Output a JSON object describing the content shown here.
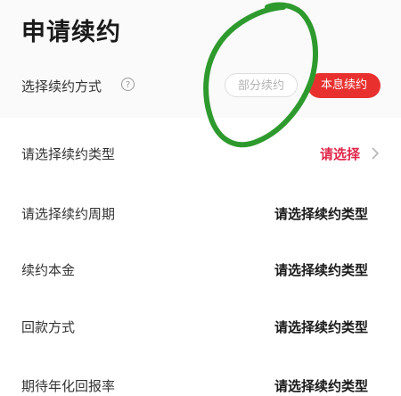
{
  "header": {
    "title": "申请续约"
  },
  "renewal_method": {
    "label": "选择续约方式",
    "help_icon": "question-circle-icon",
    "options": [
      {
        "label": "部分续约",
        "selected": false
      },
      {
        "label": "本息续约",
        "selected": true
      }
    ],
    "accent_color": "#e8312e"
  },
  "rows": [
    {
      "label": "请选择续约类型",
      "value": "请选择",
      "chevron_icon": "chevron-right-icon"
    },
    {
      "label": "请选择续约周期",
      "value": "请选择续约类型"
    },
    {
      "label": "续约本金",
      "value": "请选择续约类型"
    },
    {
      "label": "回款方式",
      "value": "请选择续约类型"
    },
    {
      "label": "期待年化回报率",
      "value": "请选择续约类型"
    }
  ],
  "annotation": {
    "type": "hand-drawn-circle",
    "color": "#2e9a2e"
  }
}
